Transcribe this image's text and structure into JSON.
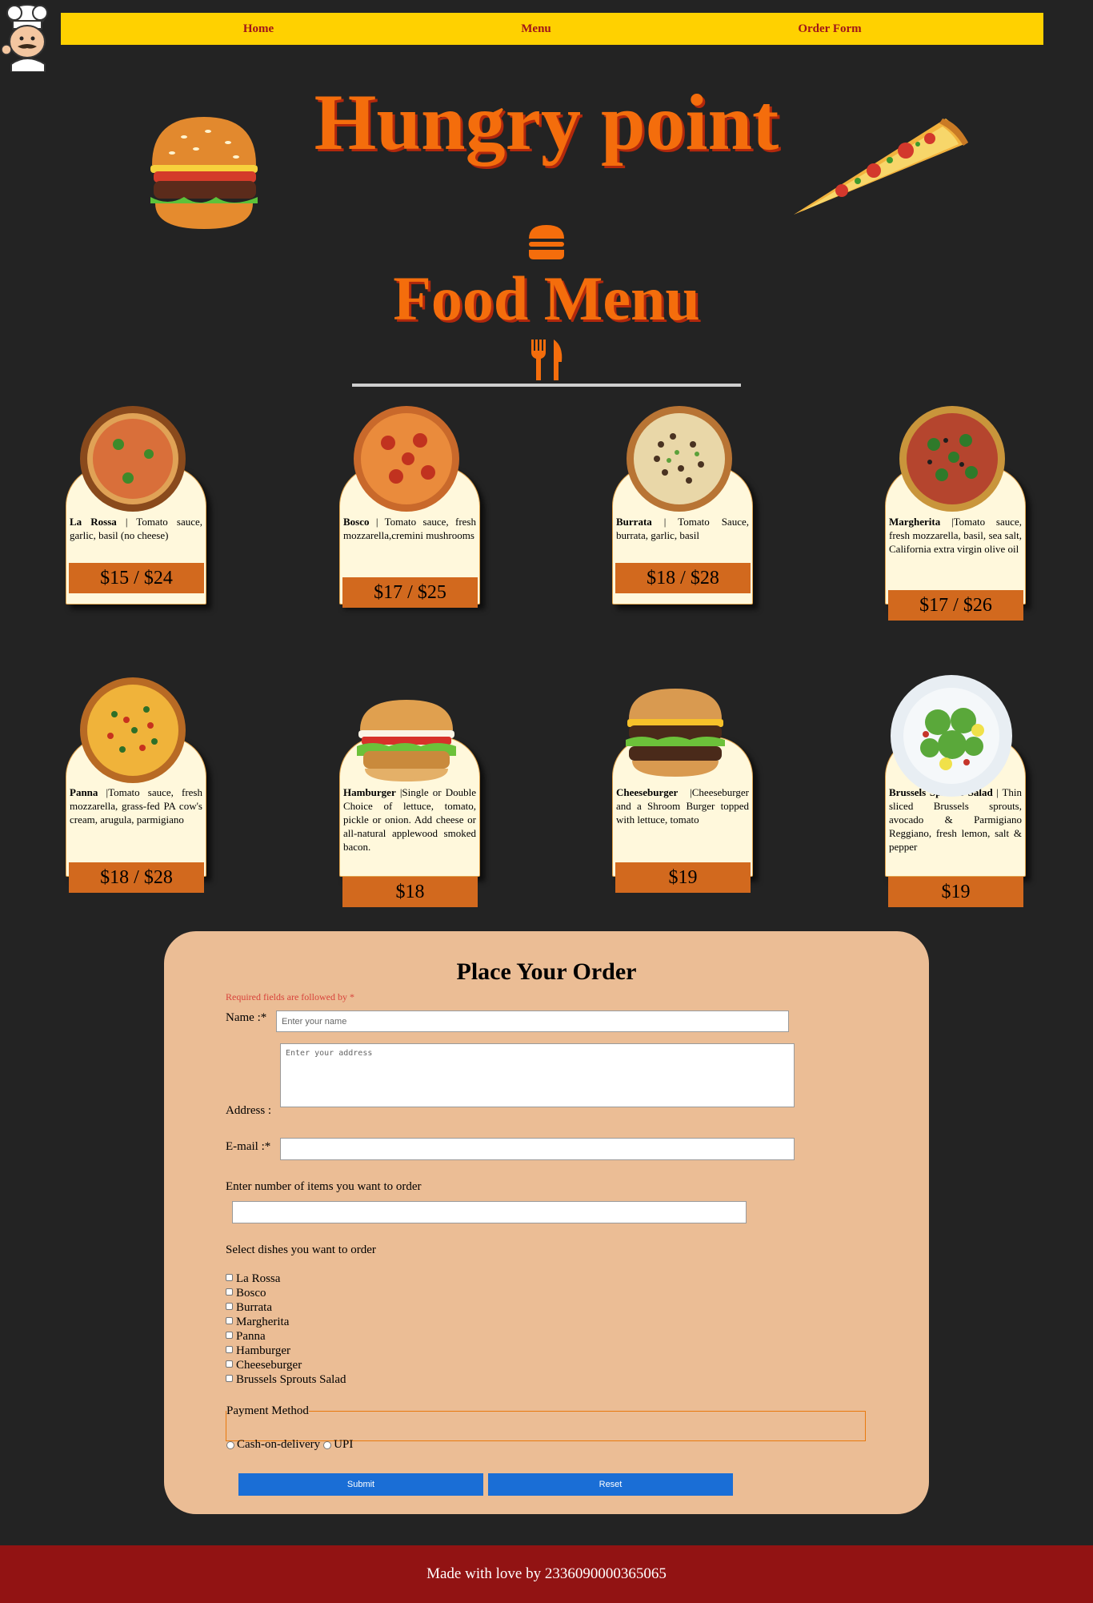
{
  "nav": {
    "home": "Home",
    "menu": "Menu",
    "order_form": "Order Form"
  },
  "brand": {
    "title": "Hungry point"
  },
  "menu_title": "Food Menu",
  "items": [
    {
      "name": "La Rossa",
      "desc": " | Tomato sauce, garlic, basil (no cheese)",
      "price": "$15 / $24"
    },
    {
      "name": "Bosco",
      "desc": " | Tomato sauce, fresh mozzarella,cremini mushrooms",
      "price": "$17 / $25"
    },
    {
      "name": "Burrata",
      "desc": " | Tomato Sauce, burrata, garlic, basil",
      "price": "$18 / $28"
    },
    {
      "name": "Margherita",
      "desc": " |Tomato sauce, fresh mozzarella, basil, sea salt, California extra virgin olive oil",
      "price": "$17 / $26"
    },
    {
      "name": "Panna",
      "desc": " |Tomato sauce, fresh mozzarella, grass-fed PA cow's cream, arugula, parmigiano",
      "price": "$18 / $28"
    },
    {
      "name": "Hamburger",
      "desc": " |Single or Double Choice of lettuce, tomato, pickle or onion. Add cheese or all-natural applewood smoked bacon.",
      "price": "$18"
    },
    {
      "name": "Cheeseburger",
      "desc": " |Cheeseburger and a Shroom Burger topped with lettuce, tomato",
      "price": "$19"
    },
    {
      "name": "Brussels Sprouts Salad",
      "desc": " | Thin sliced Brussels sprouts, avocado & Parmigiano Reggiano, fresh lemon, salt & pepper",
      "price": "$19"
    }
  ],
  "order": {
    "heading": "Place Your Order",
    "required_note": "Required fields are followed by *",
    "name_label": "Name :*",
    "name_placeholder": "Enter your name",
    "address_label": "Address :",
    "address_placeholder": "Enter your address",
    "email_label": "E-mail :*",
    "qty_label": "Enter number of items you want to order",
    "dishes_label": "Select dishes you want to order",
    "dishes": [
      "La Rossa",
      "Bosco",
      "Burrata",
      "Margherita",
      "Panna",
      "Hamburger",
      "Cheeseburger",
      "Brussels Sprouts Salad"
    ],
    "payment_legend": "Payment Method",
    "payment_options": [
      "Cash-on-delivery",
      "UPI"
    ],
    "submit": "Submit",
    "reset": "Reset"
  },
  "footer": {
    "text": "Made with love by 2336090000365065"
  },
  "colors": {
    "background": "#232323",
    "nav": "#ffd100",
    "accent": "#f46d0c",
    "price": "#d2691e",
    "form": "#ebbd95",
    "button": "#1a6ed6",
    "footer": "#921313"
  },
  "icons": [
    "chef-logo",
    "burger-image",
    "pizza-slice-image",
    "burger-icon",
    "fork-knife-icon",
    "pizza-image",
    "burger-image",
    "salad-image"
  ]
}
